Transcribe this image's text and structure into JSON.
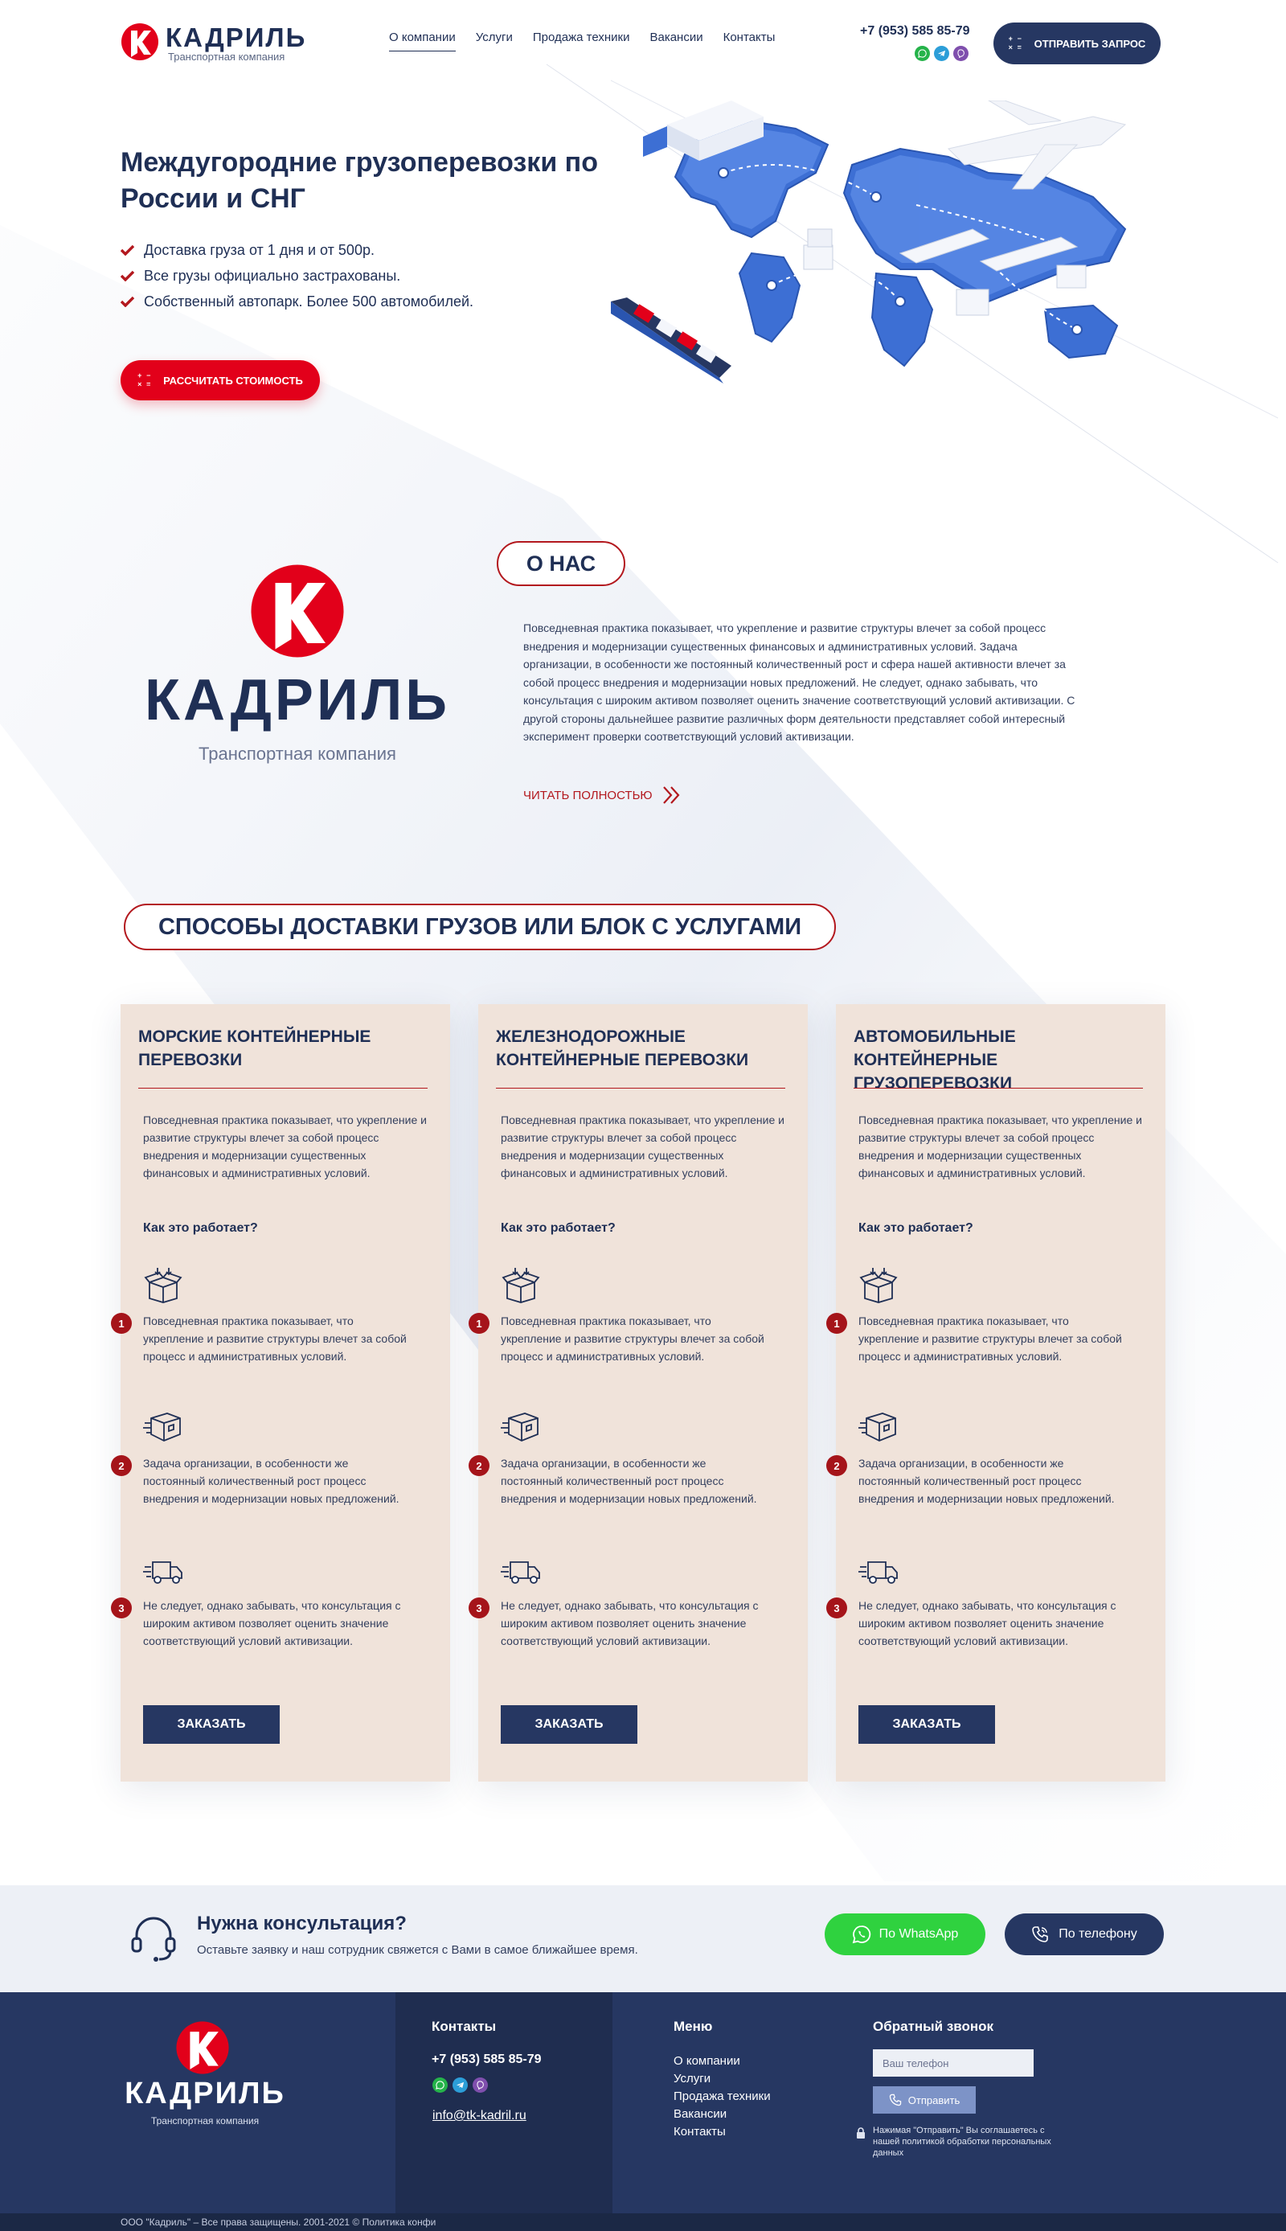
{
  "brand": {
    "name": "КАДРИЛЬ",
    "tagline": "Транспортная компания",
    "mark_letter": "K",
    "colors": {
      "primary": "#263762",
      "accent": "#e2001a",
      "accent_dark": "#b3181e",
      "card_bg": "#f0e3da"
    }
  },
  "header": {
    "nav": [
      "О компании",
      "Услуги",
      "Продажа техники",
      "Вакансии",
      "Контакты"
    ],
    "active_nav": "О компании",
    "phone": "+7 (953) 585 85-79",
    "messengers": [
      "whatsapp-icon",
      "telegram-icon",
      "viber-icon"
    ],
    "request_button": "ОТПРАВИТЬ ЗАПРОС"
  },
  "hero": {
    "title": "Междугородние грузоперевозки по России и СНГ",
    "bullets": [
      "Доставка груза от 1 дня и от 500р.",
      "Все грузы официально застрахованы.",
      "Собственный автопарк. Более 500 автомобилей."
    ],
    "cta": "РАССЧИТАТЬ СТОИМОСТЬ"
  },
  "about": {
    "badge": "О НАС",
    "text": "Повседневная практика показывает, что укрепление и развитие структуры влечет за собой процесс внедрения и модернизации существенных финансовых и административных условий. Задача организации, в особенности же постоянный количественный рост и сфера нашей активности влечет за собой процесс внедрения и модернизации новых предложений. Не следует, однако забывать, что консультация с широким активом позволяет оценить значение соответствующий условий активизации. С другой стороны дальнейшее развитие различных форм деятельности представляет собой интересный эксперимент проверки соответствующий условий активизации.",
    "read_more": "ЧИТАТЬ ПОЛНОСТЬЮ"
  },
  "services": {
    "title": "СПОСОБЫ ДОСТАВКИ ГРУЗОВ ИЛИ БЛОК С УСЛУГАМИ",
    "how_label": "Как это работает?",
    "order_label": "ЗАКАЗАТЬ",
    "cards": [
      {
        "title": "МОРСКИЕ КОНТЕЙНЕРНЫЕ ПЕРЕВОЗКИ",
        "desc": "Повседневная практика показывает, что укрепление и развитие структуры влечет за собой процесс внедрения и модернизации существенных финансовых и административных условий.",
        "steps": [
          "Повседневная практика показывает, что укрепление и развитие структуры влечет за собой процесс и административных условий.",
          "Задача организации, в особенности же постоянный количественный рост процесс внедрения и модернизации новых предложений.",
          "Не следует, однако забывать, что консультация с широким активом позволяет оценить значение соответствующий условий активизации."
        ]
      },
      {
        "title": "ЖЕЛЕЗНОДОРОЖНЫЕ КОНТЕЙНЕРНЫЕ ПЕРЕВОЗКИ",
        "desc": "Повседневная практика показывает, что укрепление и развитие структуры влечет за собой процесс внедрения и модернизации существенных финансовых и административных условий.",
        "steps": [
          "Повседневная практика показывает, что укрепление и развитие структуры влечет за собой процесс и административных условий.",
          "Задача организации, в особенности же постоянный количественный рост процесс внедрения и модернизации новых предложений.",
          "Не следует, однако забывать, что консультация с широким активом позволяет оценить значение соответствующий условий активизации."
        ]
      },
      {
        "title": "АВТОМОБИЛЬНЫЕ КОНТЕЙНЕРНЫЕ ГРУЗОПЕРЕВОЗКИ",
        "desc": "Повседневная практика показывает, что укрепление и развитие структуры влечет за собой процесс внедрения и модернизации существенных финансовых и административных условий.",
        "steps": [
          "Повседневная практика показывает, что укрепление и развитие структуры влечет за собой процесс и административных условий.",
          "Задача организации, в особенности же постоянный количественный рост процесс внедрения и модернизации новых предложений.",
          "Не следует, однако забывать, что консультация с широким активом позволяет оценить значение соответствующий условий активизации."
        ]
      }
    ]
  },
  "consult": {
    "title": "Нужна консультация?",
    "subtitle": "Оставьте заявку и наш сотрудник свяжется с Вами в самое ближайшее время.",
    "whatsapp_button": "По WhatsApp",
    "phone_button": "По телефону"
  },
  "footer": {
    "contacts_title": "Контакты",
    "phone": "+7 (953) 585 85-79",
    "email": "info@tk-kadril.ru",
    "menu_title": "Меню",
    "menu": [
      "О компании",
      "Услуги",
      "Продажа техники",
      "Вакансии",
      "Контакты"
    ],
    "callback_title": "Обратный звонок",
    "phone_placeholder": "Ваш телефон",
    "send_button": "Отправить",
    "note": "Нажимая \"Отправить\" Вы соглашаетесь с нашей политикой обработки персональных данных",
    "copyright": "ООО \"Кадриль\" – Все права защищены. 2001-2021 © Политика конфи"
  }
}
